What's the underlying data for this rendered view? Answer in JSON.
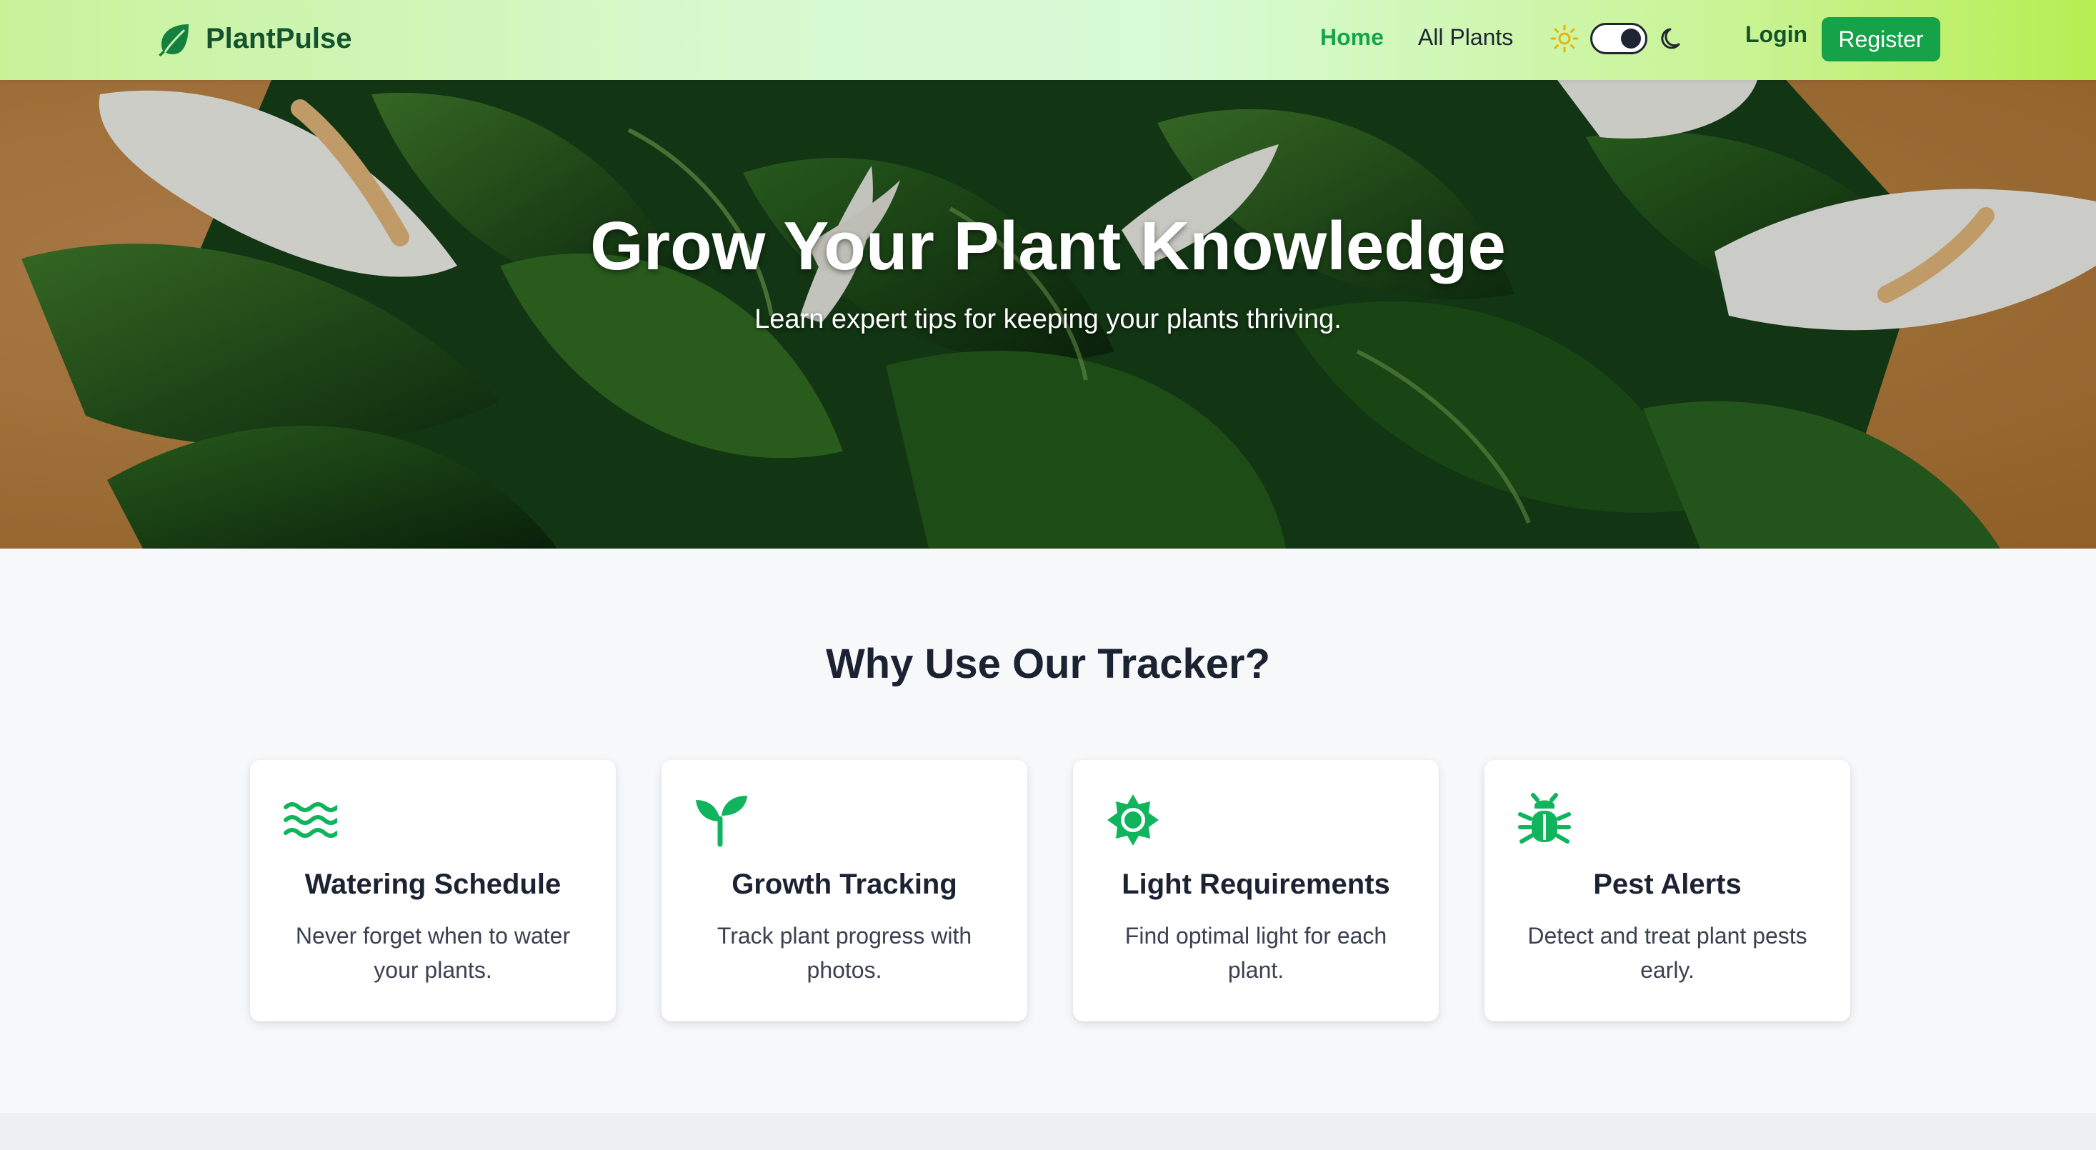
{
  "brand": {
    "name": "PlantPulse",
    "icon": "leaf-icon"
  },
  "nav": {
    "links": [
      {
        "label": "Home",
        "active": true
      },
      {
        "label": "All Plants",
        "active": false
      }
    ],
    "theme_toggle": {
      "light_icon": "sun-icon",
      "dark_icon": "moon-icon",
      "mode": "dark"
    },
    "login_label": "Login",
    "register_label": "Register"
  },
  "hero": {
    "title": "Grow Your Plant Knowledge",
    "subtitle": "Learn expert tips for keeping your plants thriving."
  },
  "features": {
    "heading": "Why Use Our Tracker?",
    "cards": [
      {
        "icon": "water-waves-icon",
        "title": "Watering Schedule",
        "text": "Never forget when to water your plants."
      },
      {
        "icon": "seedling-icon",
        "title": "Growth Tracking",
        "text": "Track plant progress with photos."
      },
      {
        "icon": "sun-icon",
        "title": "Light Requirements",
        "text": "Find optimal light for each plant."
      },
      {
        "icon": "bug-icon",
        "title": "Pest Alerts",
        "text": "Detect and treat plant pests early."
      }
    ]
  },
  "colors": {
    "accent": "#16a34a",
    "brand_dark": "#14532d",
    "icon_green": "#10b45c",
    "register_bg": "#15a249"
  }
}
